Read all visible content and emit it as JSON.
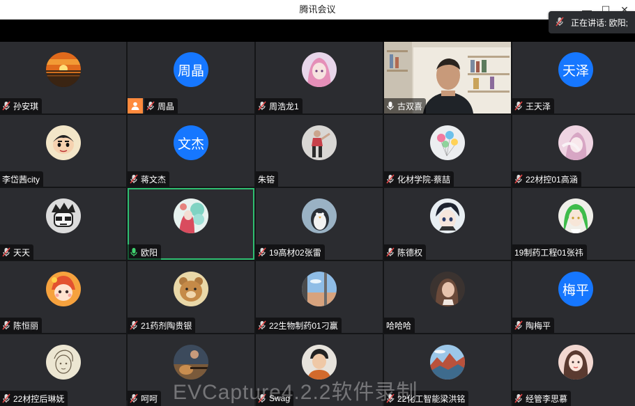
{
  "window": {
    "title": "腾讯会议",
    "min": "—",
    "max": "☐",
    "close": "✕"
  },
  "speaking": {
    "text": "正在讲话: 欧阳;"
  },
  "participants": [
    {
      "name": "孙安琪",
      "mic": "muted",
      "avatar": "sunset"
    },
    {
      "name": "周晶",
      "mic": "muted",
      "avatar_text": "周晶",
      "host": true
    },
    {
      "name": "周浩龙1",
      "mic": "muted",
      "avatar": "anime-girl-pink"
    },
    {
      "name": "古双喜",
      "mic": "on",
      "video": true
    },
    {
      "name": "王天泽",
      "mic": "muted",
      "avatar_text": "天泽"
    },
    {
      "name": "李岱茜city",
      "mic": "none",
      "avatar": "crayon-shin"
    },
    {
      "name": "蒋文杰",
      "mic": "muted",
      "avatar_text": "文杰"
    },
    {
      "name": "朱镕",
      "mic": "none",
      "avatar": "dancer"
    },
    {
      "name": "化材学院-蔡喆",
      "mic": "muted",
      "avatar": "balloons"
    },
    {
      "name": "22材控01高涵",
      "mic": "muted",
      "avatar": "pink-anime"
    },
    {
      "name": "天天",
      "mic": "muted",
      "avatar": "monochrome-cartoon"
    },
    {
      "name": "欧阳",
      "mic": "speaking",
      "avatar": "floral-girl",
      "active": true
    },
    {
      "name": "19高材02张雷",
      "mic": "muted",
      "avatar": "penguin"
    },
    {
      "name": "陈德权",
      "mic": "muted",
      "avatar": "anime-boy"
    },
    {
      "name": "19制药工程01张祎",
      "mic": "none",
      "avatar": "green-hair"
    },
    {
      "name": "陈恒丽",
      "mic": "muted",
      "avatar": "cartoon-orange"
    },
    {
      "name": "21药剂陶贵银",
      "mic": "muted",
      "avatar": "bear"
    },
    {
      "name": "22生物制药01刁赢",
      "mic": "muted",
      "avatar": "window-sky"
    },
    {
      "name": "哈哈哈",
      "mic": "none",
      "avatar": "girl-dark"
    },
    {
      "name": "陶梅平",
      "mic": "muted",
      "avatar_text": "梅平"
    },
    {
      "name": "22材控后琳妩",
      "mic": "muted",
      "avatar": "sketch"
    },
    {
      "name": "呵呵",
      "mic": "muted",
      "avatar": "guitar"
    },
    {
      "name": "Swag",
      "mic": "muted",
      "avatar": "boy-photo"
    },
    {
      "name": "22化工智能梁洪铭",
      "mic": "muted",
      "avatar": "landscape"
    },
    {
      "name": "经管李思慕",
      "mic": "muted",
      "avatar": "girl-selfie"
    }
  ],
  "watermark": "EVCapture4.2.2软件录制",
  "colors": {
    "accent": "#1677ff",
    "active_border": "#2fbf71",
    "host_badge": "#ff8a3d",
    "tile_bg": "#2b2c30"
  }
}
